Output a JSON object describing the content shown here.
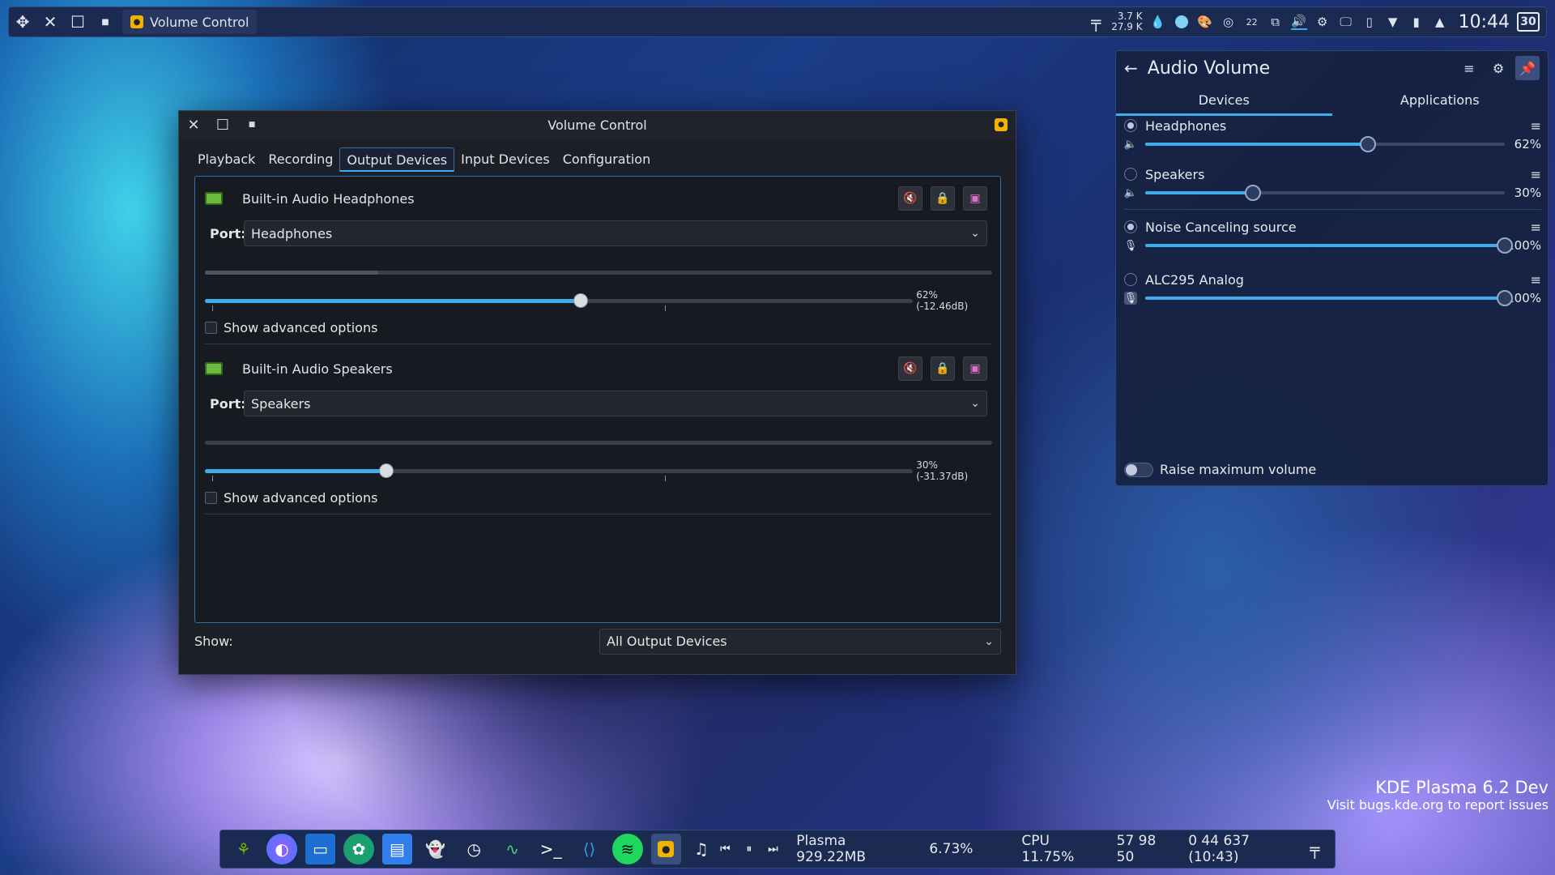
{
  "top_panel": {
    "task_title": "Volume Control",
    "net_up": "3.7 K",
    "net_down": "27.9 K",
    "notif_count": "22",
    "clock": "10:44",
    "date": "30"
  },
  "vc_window": {
    "title": "Volume Control",
    "tabs": [
      "Playback",
      "Recording",
      "Output Devices",
      "Input Devices",
      "Configuration"
    ],
    "active_tab": "Output Devices",
    "port_label": "Port:",
    "show_advanced": "Show advanced options",
    "devices": [
      {
        "name": "Built-in Audio Headphones",
        "port": "Headphones",
        "volume_percent": 62,
        "volume_text": "62% (-12.46dB)",
        "meter_level": 0.22
      },
      {
        "name": "Built-in Audio Speakers",
        "port": "Speakers",
        "volume_percent": 30,
        "volume_text": "30% (-31.37dB)",
        "meter_level": 0
      }
    ],
    "show_label": "Show:",
    "show_value": "All Output Devices"
  },
  "audio_popup": {
    "title": "Audio Volume",
    "tabs": [
      "Devices",
      "Applications"
    ],
    "active_tab": "Devices",
    "items": [
      {
        "name": "Headphones",
        "pct": "62%",
        "value": 62,
        "selected": true,
        "kind": "speaker"
      },
      {
        "name": "Speakers",
        "pct": "30%",
        "value": 30,
        "selected": false,
        "kind": "speaker"
      },
      {
        "name": "Noise Canceling source",
        "pct": "100%",
        "value": 100,
        "selected": true,
        "kind": "mic"
      },
      {
        "name": "ALC295 Analog",
        "pct": "100%",
        "value": 100,
        "selected": false,
        "kind": "mic-muted"
      }
    ],
    "raise_label": "Raise maximum volume"
  },
  "watermark": {
    "title": "KDE Plasma 6.2 Dev",
    "subtitle": "Visit bugs.kde.org to report issues"
  },
  "bottom_panel": {
    "plasma_mem": "Plasma 929.22MB",
    "cpu_plasma": "6.73%",
    "cpu_total": "CPU 11.75%",
    "load": "57 98 50",
    "uptime": "0 44 637 (10:43)"
  },
  "colors": {
    "accent": "#3daee9",
    "panel": "#1b2a50",
    "window": "#1c1f26"
  }
}
